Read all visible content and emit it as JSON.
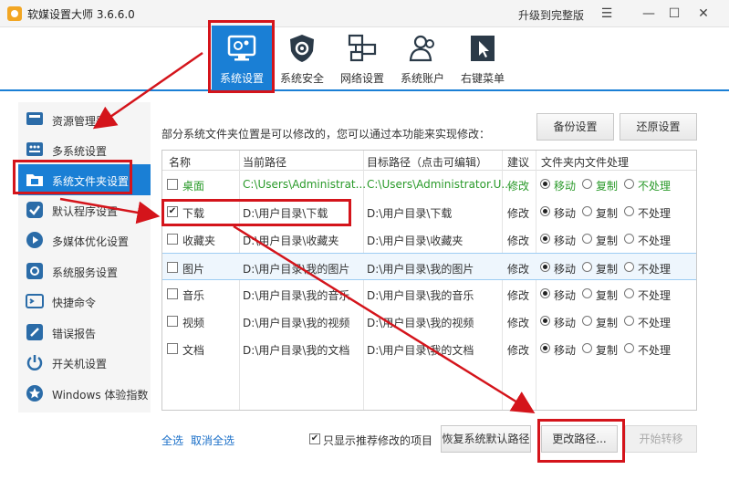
{
  "app": {
    "title": "软媒设置大师 3.6.6.0",
    "upgrade": "升级到完整版"
  },
  "tabs": [
    {
      "label": "系统设置",
      "icon": "gear-monitor-icon",
      "active": true
    },
    {
      "label": "系统安全",
      "icon": "shield-gear-icon",
      "active": false
    },
    {
      "label": "网络设置",
      "icon": "network-icon",
      "active": false
    },
    {
      "label": "系统账户",
      "icon": "users-icon",
      "active": false
    },
    {
      "label": "右键菜单",
      "icon": "cursor-icon",
      "active": false
    }
  ],
  "sidebar": {
    "items": [
      {
        "label": "资源管理器",
        "icon": "monitor-icon"
      },
      {
        "label": "多系统设置",
        "icon": "multi-system-icon"
      },
      {
        "label": "系统文件夹设置",
        "icon": "folder-window-icon",
        "active": true
      },
      {
        "label": "默认程序设置",
        "icon": "check-shield-icon"
      },
      {
        "label": "多媒体优化设置",
        "icon": "media-icon"
      },
      {
        "label": "系统服务设置",
        "icon": "service-gear-icon"
      },
      {
        "label": "快捷命令",
        "icon": "command-icon"
      },
      {
        "label": "错误报告",
        "icon": "report-icon"
      },
      {
        "label": "开关机设置",
        "icon": "power-icon"
      },
      {
        "label": "Windows 体验指数",
        "icon": "star-icon"
      }
    ]
  },
  "main": {
    "description": "部分系统文件夹位置是可以修改的，您可以通过本功能来实现修改：",
    "backup_label": "备份设置",
    "restore_label": "还原设置",
    "columns": [
      "名称",
      "当前路径",
      "目标路径（点击可编辑）",
      "建议",
      "文件夹内文件处理"
    ],
    "options": [
      "移动",
      "复制",
      "不处理"
    ],
    "rows": [
      {
        "checked": false,
        "name": "桌面",
        "current": "C:\\Users\\Administrat...",
        "target": "C:\\Users\\Administrator.U...",
        "advice": "修改",
        "green": true
      },
      {
        "checked": true,
        "name": "下载",
        "current": "D:\\用户目录\\下载",
        "target": "D:\\用户目录\\下载",
        "advice": "修改",
        "green": false
      },
      {
        "checked": false,
        "name": "收藏夹",
        "current": "D:\\用户目录\\收藏夹",
        "target": "D:\\用户目录\\收藏夹",
        "advice": "修改",
        "green": false
      },
      {
        "checked": false,
        "name": "图片",
        "current": "D:\\用户目录\\我的图片",
        "target": "D:\\用户目录\\我的图片",
        "advice": "修改",
        "green": false
      },
      {
        "checked": false,
        "name": "音乐",
        "current": "D:\\用户目录\\我的音乐",
        "target": "D:\\用户目录\\我的音乐",
        "advice": "修改",
        "green": false
      },
      {
        "checked": false,
        "name": "视频",
        "current": "D:\\用户目录\\我的视频",
        "target": "D:\\用户目录\\我的视频",
        "advice": "修改",
        "green": false
      },
      {
        "checked": false,
        "name": "文档",
        "current": "D:\\用户目录\\我的文档",
        "target": "D:\\用户目录\\我的文档",
        "advice": "修改",
        "green": false
      }
    ]
  },
  "bottom": {
    "select_all": "全选",
    "deselect_all": "取消全选",
    "only_recommended": "只显示推荐修改的项目",
    "only_recommended_checked": true,
    "restore_default": "恢复系统默认路径",
    "change_path": "更改路径...",
    "start_move": "开始转移"
  },
  "colors": {
    "accent": "#1a7fd5",
    "annotation": "#d4141b",
    "green": "#2a9a2a",
    "link": "#1a6fc8"
  }
}
